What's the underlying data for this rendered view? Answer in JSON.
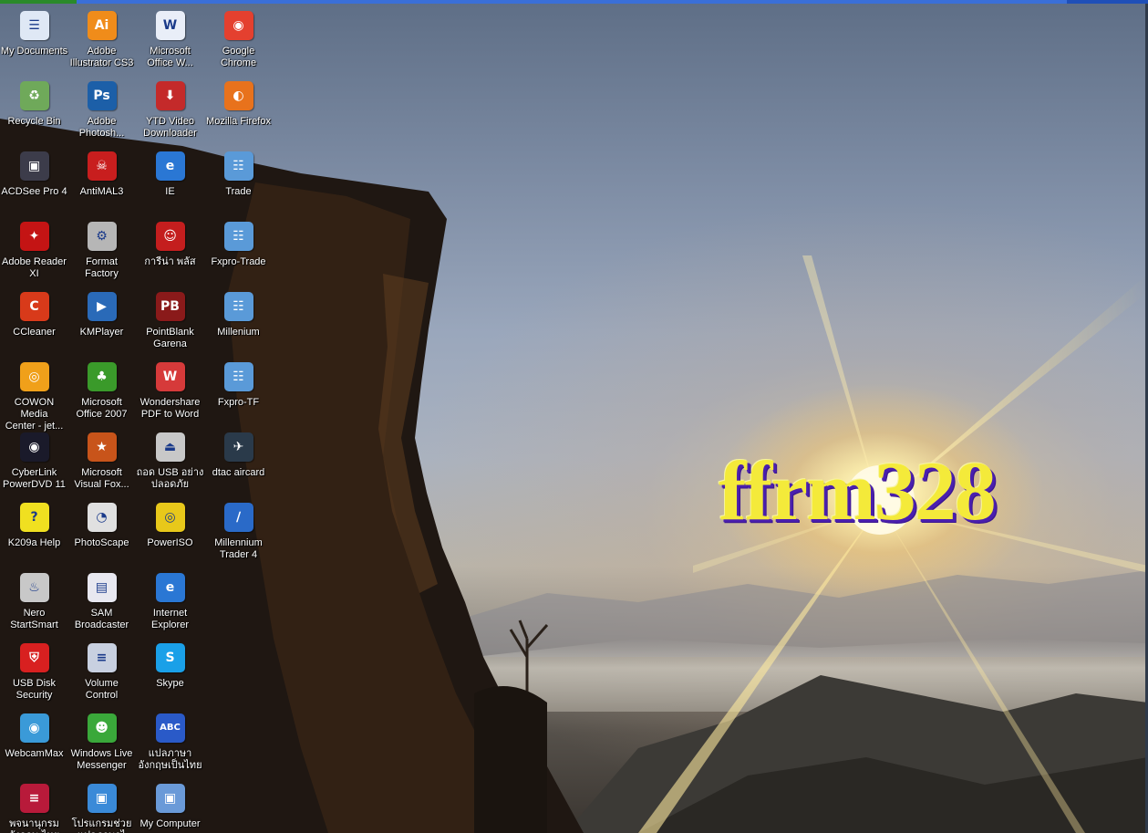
{
  "desktop": {
    "brand_text": "ffrm328"
  },
  "icons": [
    {
      "label": "My Documents",
      "icon": "documents-icon",
      "color": "#dfe8f5",
      "glyph": "☰"
    },
    {
      "label": "Adobe\nIllustrator CS3",
      "icon": "illustrator-icon",
      "color": "#f08c1a",
      "glyph": "Ai"
    },
    {
      "label": "Microsoft\nOffice W...",
      "icon": "word-icon",
      "color": "#e9eef8",
      "glyph": "W"
    },
    {
      "label": "Google\nChrome",
      "icon": "chrome-icon",
      "color": "#e4402f",
      "glyph": "◉"
    },
    {
      "label": "Recycle Bin",
      "icon": "recycle-bin-icon",
      "color": "#6fa95a",
      "glyph": "♻"
    },
    {
      "label": "Adobe\nPhotosh...",
      "icon": "photoshop-icon",
      "color": "#1c5fa8",
      "glyph": "Ps"
    },
    {
      "label": "YTD Video\nDownloader",
      "icon": "ytd-downloader-icon",
      "color": "#c42a2a",
      "glyph": "⬇"
    },
    {
      "label": "Mozilla Firefox",
      "icon": "firefox-icon",
      "color": "#e8721c",
      "glyph": "◐"
    },
    {
      "label": "ACDSee Pro 4",
      "icon": "camera-icon",
      "color": "#3c3c4a",
      "glyph": "▣"
    },
    {
      "label": "AntiMAL3",
      "icon": "spider-icon",
      "color": "#c81e1e",
      "glyph": "☠"
    },
    {
      "label": "IE",
      "icon": "ie-icon",
      "color": "#2a77d4",
      "glyph": "e"
    },
    {
      "label": "Trade",
      "icon": "trade-icon",
      "color": "#5a9ad8",
      "glyph": "☷"
    },
    {
      "label": "Adobe Reader\nXI",
      "icon": "pdf-reader-icon",
      "color": "#c41414",
      "glyph": "✦"
    },
    {
      "label": "Format\nFactory",
      "icon": "format-factory-icon",
      "color": "#b6b6b6",
      "glyph": "⚙"
    },
    {
      "label": "การีน่า พลัส",
      "icon": "garena-icon",
      "color": "#c41e1e",
      "glyph": "☺"
    },
    {
      "label": "Fxpro-Trade",
      "icon": "fxpro-trade-icon",
      "color": "#5a9ad8",
      "glyph": "☷"
    },
    {
      "label": "CCleaner",
      "icon": "ccleaner-icon",
      "color": "#d83a1a",
      "glyph": "C"
    },
    {
      "label": "KMPlayer",
      "icon": "kmplayer-icon",
      "color": "#2a6ab8",
      "glyph": "▶"
    },
    {
      "label": "PointBlank\nGarena",
      "icon": "pointblank-icon",
      "color": "#8a1a1a",
      "glyph": "PB"
    },
    {
      "label": "Millenium",
      "icon": "millenium-icon",
      "color": "#5a9ad8",
      "glyph": "☷"
    },
    {
      "label": "COWON Media\nCenter - jet...",
      "icon": "cowon-icon",
      "color": "#f0a01a",
      "glyph": "◎"
    },
    {
      "label": "Microsoft\nOffice 2007",
      "icon": "tree-icon",
      "color": "#3a9a2a",
      "glyph": "♣"
    },
    {
      "label": "Wondershare\nPDF to Word",
      "icon": "pdf-to-word-icon",
      "color": "#d63a3a",
      "glyph": "W"
    },
    {
      "label": "Fxpro-TF",
      "icon": "fxpro-tf-icon",
      "color": "#5a9ad8",
      "glyph": "☷"
    },
    {
      "label": "CyberLink\nPowerDVD 11",
      "icon": "powerdvd-icon",
      "color": "#1a1a2a",
      "glyph": "◉"
    },
    {
      "label": "Microsoft\nVisual Fox...",
      "icon": "foxpro-icon",
      "color": "#c8541a",
      "glyph": "★"
    },
    {
      "label": "ถอด USB อย่าง\nปลอดภัย",
      "icon": "usb-eject-icon",
      "color": "#c8c8c8",
      "glyph": "⏏"
    },
    {
      "label": "dtac aircard",
      "icon": "dtac-icon",
      "color": "#2a3a4a",
      "glyph": "✈"
    },
    {
      "label": "K209a Help",
      "icon": "help-icon",
      "color": "#f0e020",
      "glyph": "?"
    },
    {
      "label": "PhotoScape",
      "icon": "photoscape-icon",
      "color": "#e0e0e0",
      "glyph": "◔"
    },
    {
      "label": "PowerISO",
      "icon": "disc-icon",
      "color": "#e8c81a",
      "glyph": "◎"
    },
    {
      "label": "Millennium\nTrader 4",
      "icon": "millennium-trader-icon",
      "color": "#2a6ac8",
      "glyph": "∕"
    },
    {
      "label": "Nero\nStartSmart",
      "icon": "nero-icon",
      "color": "#c8c8c8",
      "glyph": "♨"
    },
    {
      "label": "SAM\nBroadcaster",
      "icon": "window-icon",
      "color": "#e8e8f0",
      "glyph": "▤"
    },
    {
      "label": "Internet\nExplorer",
      "icon": "internet-explorer-icon",
      "color": "#2a77d4",
      "glyph": "e"
    },
    {
      "label": "",
      "icon": "",
      "color": "",
      "glyph": ""
    },
    {
      "label": "USB Disk\nSecurity",
      "icon": "shield-icon",
      "color": "#d82020",
      "glyph": "⛨"
    },
    {
      "label": "Volume\nControl",
      "icon": "volume-control-icon",
      "color": "#c8d0e0",
      "glyph": "≡"
    },
    {
      "label": "Skype",
      "icon": "skype-icon",
      "color": "#1aa0e8",
      "glyph": "S"
    },
    {
      "label": "",
      "icon": "",
      "color": "",
      "glyph": ""
    },
    {
      "label": "WebcamMax",
      "icon": "webcam-icon",
      "color": "#3a9ad8",
      "glyph": "◉"
    },
    {
      "label": "Windows Live\nMessenger",
      "icon": "messenger-icon",
      "color": "#3aa83a",
      "glyph": "☻"
    },
    {
      "label": "แปลภาษา\nอังกฤษเป็นไทย",
      "icon": "translate-icon",
      "color": "#2a5ac8",
      "glyph": "ABC"
    },
    {
      "label": "",
      "icon": "",
      "color": "",
      "glyph": ""
    },
    {
      "label": "พจนานุกรม\nอังกฤษ-ไทย",
      "icon": "dictionary-icon",
      "color": "#b81a3a",
      "glyph": "≡"
    },
    {
      "label": "โปรแกรมช่วย\nแปลภาษาไ",
      "icon": "translator-program-icon",
      "color": "#3a8ad8",
      "glyph": "▣"
    },
    {
      "label": "My Computer",
      "icon": "computer-icon",
      "color": "#6a9ad8",
      "glyph": "▣"
    },
    {
      "label": "",
      "icon": "",
      "color": "",
      "glyph": ""
    }
  ]
}
